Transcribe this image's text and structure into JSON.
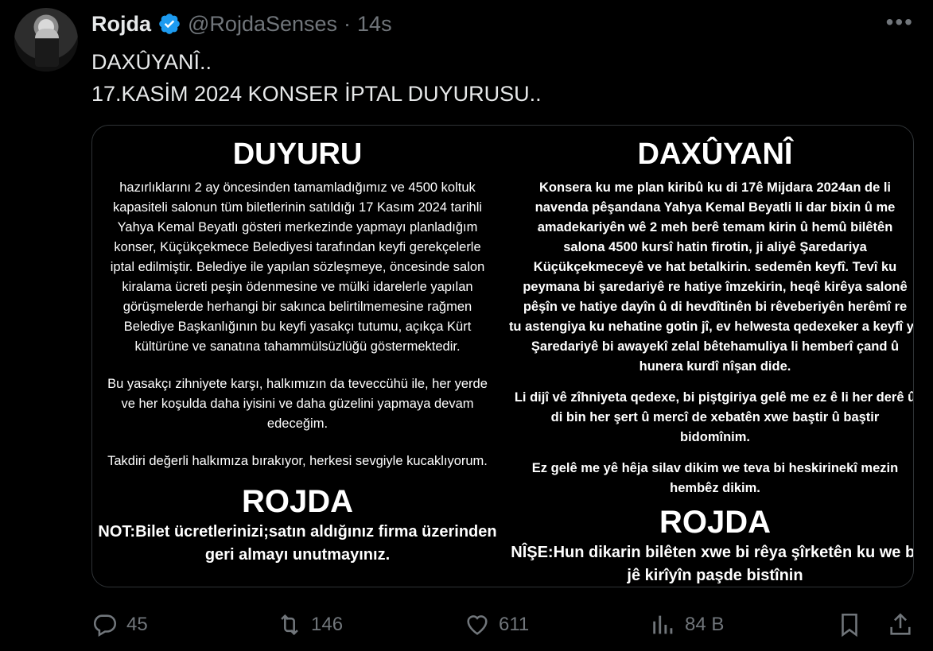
{
  "author": {
    "name": "Rojda",
    "handle": "@RojdaSenses",
    "separator": "·",
    "time": "14s"
  },
  "tweet_text": {
    "line1": "DAXÛYANÎ..",
    "line2": "17.KASİM 2024 KONSER İPTAL DUYURUSU.."
  },
  "media": {
    "left": {
      "heading": "DUYURU",
      "lines": [
        "hazırlıklarını 2 ay öncesinden tamamladığımız ve 4500 koltuk",
        "kapasiteli salonun tüm biletlerinin satıldığı 17 Kasım  2024 tarihli",
        "Yahya Kemal Beyatlı gösteri merkezinde yapmayı planladığım",
        "konser, Küçükçekmece Belediyesi tarafından keyfi gerekçelerle",
        "iptal edilmiştir. Belediye ile yapılan sözleşmeye, öncesinde salon",
        "kiralama ücreti peşin ödenmesine ve mülki idarelerle yapılan",
        "görüşmelerde herhangi bir sakınca belirtilmemesine rağmen",
        "Belediye Başkanlığının bu keyfi yasakçı tutumu,  açıkça Kürt",
        "kültürüne ve sanatına tahammülsüzlüğü göstermektedir."
      ],
      "lines2": [
        "Bu yasakçı zihniyete karşı, halkımızın da teveccühü ile, her yerde",
        "ve her koşulda daha iyisini ve daha güzelini yapmaya devam",
        "edeceğim."
      ],
      "lines3": [
        "Takdiri değerli halkımıza bırakıyor, herkesi sevgiyle kucaklıyorum."
      ],
      "signature": "ROJDA",
      "note_lines": [
        "NOT:Bilet ücretlerinizi;satın aldığınız firma üzerinden",
        "geri almayı unutmayınız."
      ]
    },
    "right": {
      "heading": "DAXÛYANÎ",
      "lines": [
        "Konsera ku me plan kiribû ku di 17ê Mijdara 2024an de li",
        "navenda pêşandana Yahya Kemal Beyatli li dar bixin û me",
        "amadekariyên wê 2 meh berê temam kirin û hemû bilêtên",
        "salona 4500 kursî hatin firotin, ji aliyê Şaredariya",
        "Küçükçekmeceyê ve hat betalkirin. sedemên keyfî.  Tevî ku",
        "peymana bi şaredariyê re hatiye îmzekirin, heqê kirêya salonê",
        "pêşîn ve hatiye dayîn û di hevdîtinên bi rêveberiyên herêmî re",
        "tu astengiya ku nehatine gotin jî, ev helwesta qedexeker a keyfî ya",
        "Şaredariyê bi awayekî zelal bêtehamuliya li hemberî çand û",
        "hunera kurdî nîşan dide."
      ],
      "lines2": [
        "Li dijî vê zîhniyeta qedexe, bi piştgiriya gelê me ez ê li her derê û",
        "di bin her şert û mercî de xebatên xwe baştir û baştir",
        "bidomînim."
      ],
      "lines3": [
        "Ez gelê me yê hêja silav dikim we teva bi heskirinekî mezin",
        "hembêz dikim."
      ],
      "signature": "ROJDA",
      "note_lines": [
        "NÎŞE:Hun dikarin bilêten xwe bi rêya şîrketên ku we bi",
        "jê kirîyîn paşde bistînin"
      ]
    }
  },
  "actions": {
    "replies": "45",
    "reposts": "146",
    "likes": "611",
    "views": "84 B"
  },
  "icons": {
    "verified": "verified-badge-icon",
    "more": "more-icon",
    "reply": "reply-icon",
    "repost": "repost-icon",
    "like": "heart-icon",
    "views": "views-icon",
    "bookmark": "bookmark-icon",
    "share": "share-icon"
  },
  "colors": {
    "verified": "#1d9bf0",
    "muted": "#71767b",
    "text": "#e7e9ea",
    "background": "#000000"
  }
}
